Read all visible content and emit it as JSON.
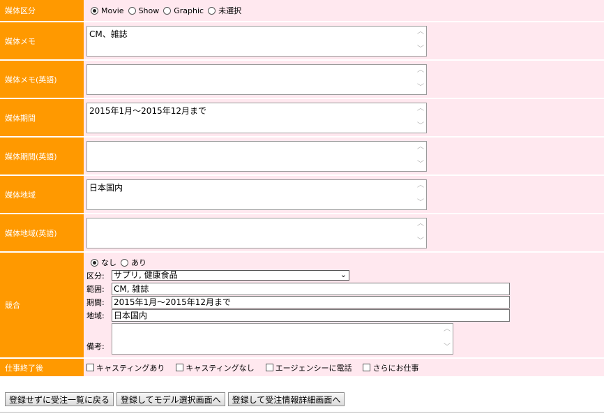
{
  "media_type": {
    "label": "媒体区分",
    "options": [
      {
        "label": "Movie",
        "checked": true
      },
      {
        "label": "Show",
        "checked": false
      },
      {
        "label": "Graphic",
        "checked": false
      },
      {
        "label": "未選択",
        "checked": false
      }
    ]
  },
  "fields": [
    {
      "label": "媒体メモ",
      "value": "CM、雑誌"
    },
    {
      "label": "媒体メモ(英語)",
      "value": ""
    },
    {
      "label": "媒体期間",
      "value": "2015年1月～2015年12月まで"
    },
    {
      "label": "媒体期間(英語)",
      "value": ""
    },
    {
      "label": "媒体地域",
      "value": "日本国内"
    },
    {
      "label": "媒体地域(英語)",
      "value": ""
    }
  ],
  "competition": {
    "label": "競合",
    "options": [
      {
        "label": "なし",
        "checked": true
      },
      {
        "label": "あり",
        "checked": false
      }
    ],
    "category_label": "区分:",
    "category_value": "サプリ, 健康食品",
    "scope_label": "範囲:",
    "scope_value": "CM, 雑誌",
    "period_label": "期間:",
    "period_value": "2015年1月～2015年12月まで",
    "region_label": "地域:",
    "region_value": "日本国内",
    "note_label": "備考:",
    "note_value": ""
  },
  "after_job": {
    "label": "仕事終了後",
    "checkboxes": [
      "キャスティングあり",
      "キャスティングなし",
      "エージェンシーに電話",
      "さらにお仕事"
    ]
  },
  "buttons": {
    "back": "登録せずに受注一覧に戻る",
    "to_model": "登録してモデル選択画面へ",
    "to_detail": "登録して受注情報詳細画面へ"
  },
  "colors": {
    "label_bg": "#ff9900",
    "value_bg": "#ffe8ef"
  }
}
